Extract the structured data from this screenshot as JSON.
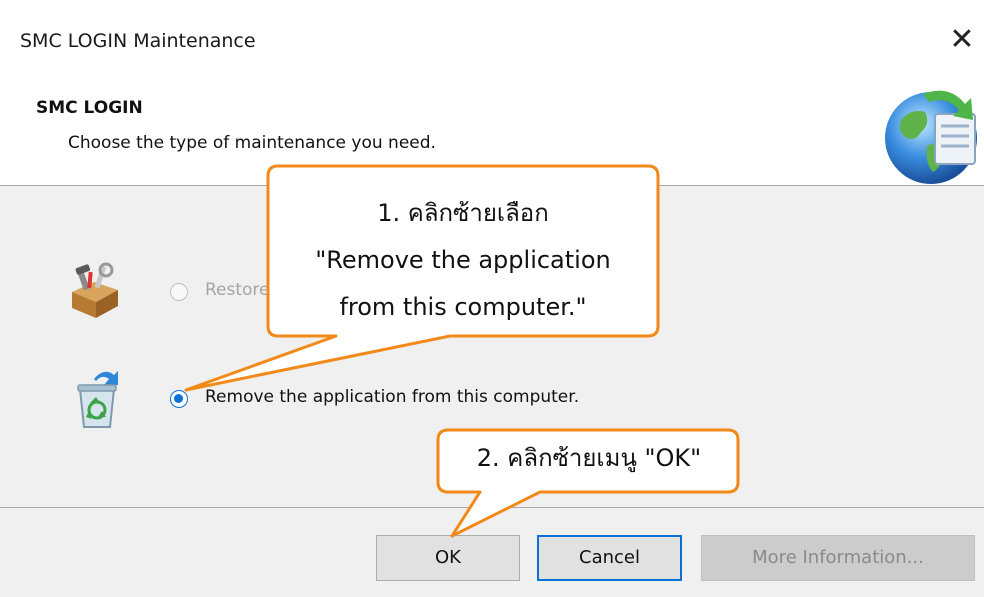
{
  "window": {
    "title": "SMC LOGIN Maintenance"
  },
  "header": {
    "title": "SMC LOGIN",
    "subtitle": "Choose the type of maintenance you need."
  },
  "options": [
    {
      "label": "Restore the application to its original state.",
      "selected": false,
      "enabled": false,
      "icon": "toolbox-icon"
    },
    {
      "label": "Remove the application from this computer.",
      "selected": true,
      "enabled": true,
      "icon": "recycle-bin-icon"
    }
  ],
  "buttons": {
    "ok": "OK",
    "cancel": "Cancel",
    "more_info": "More Information..."
  },
  "callouts": {
    "step1": {
      "line1": "1. คลิกซ้ายเลือก",
      "line2": "\"Remove the application",
      "line3": "from this computer.\""
    },
    "step2": {
      "text": "2. คลิกซ้ายเมนู \"OK\""
    }
  },
  "colors": {
    "accent": "#0a72d6",
    "callout_border": "#f28a1a",
    "panel_bg": "#f0f0f0"
  }
}
